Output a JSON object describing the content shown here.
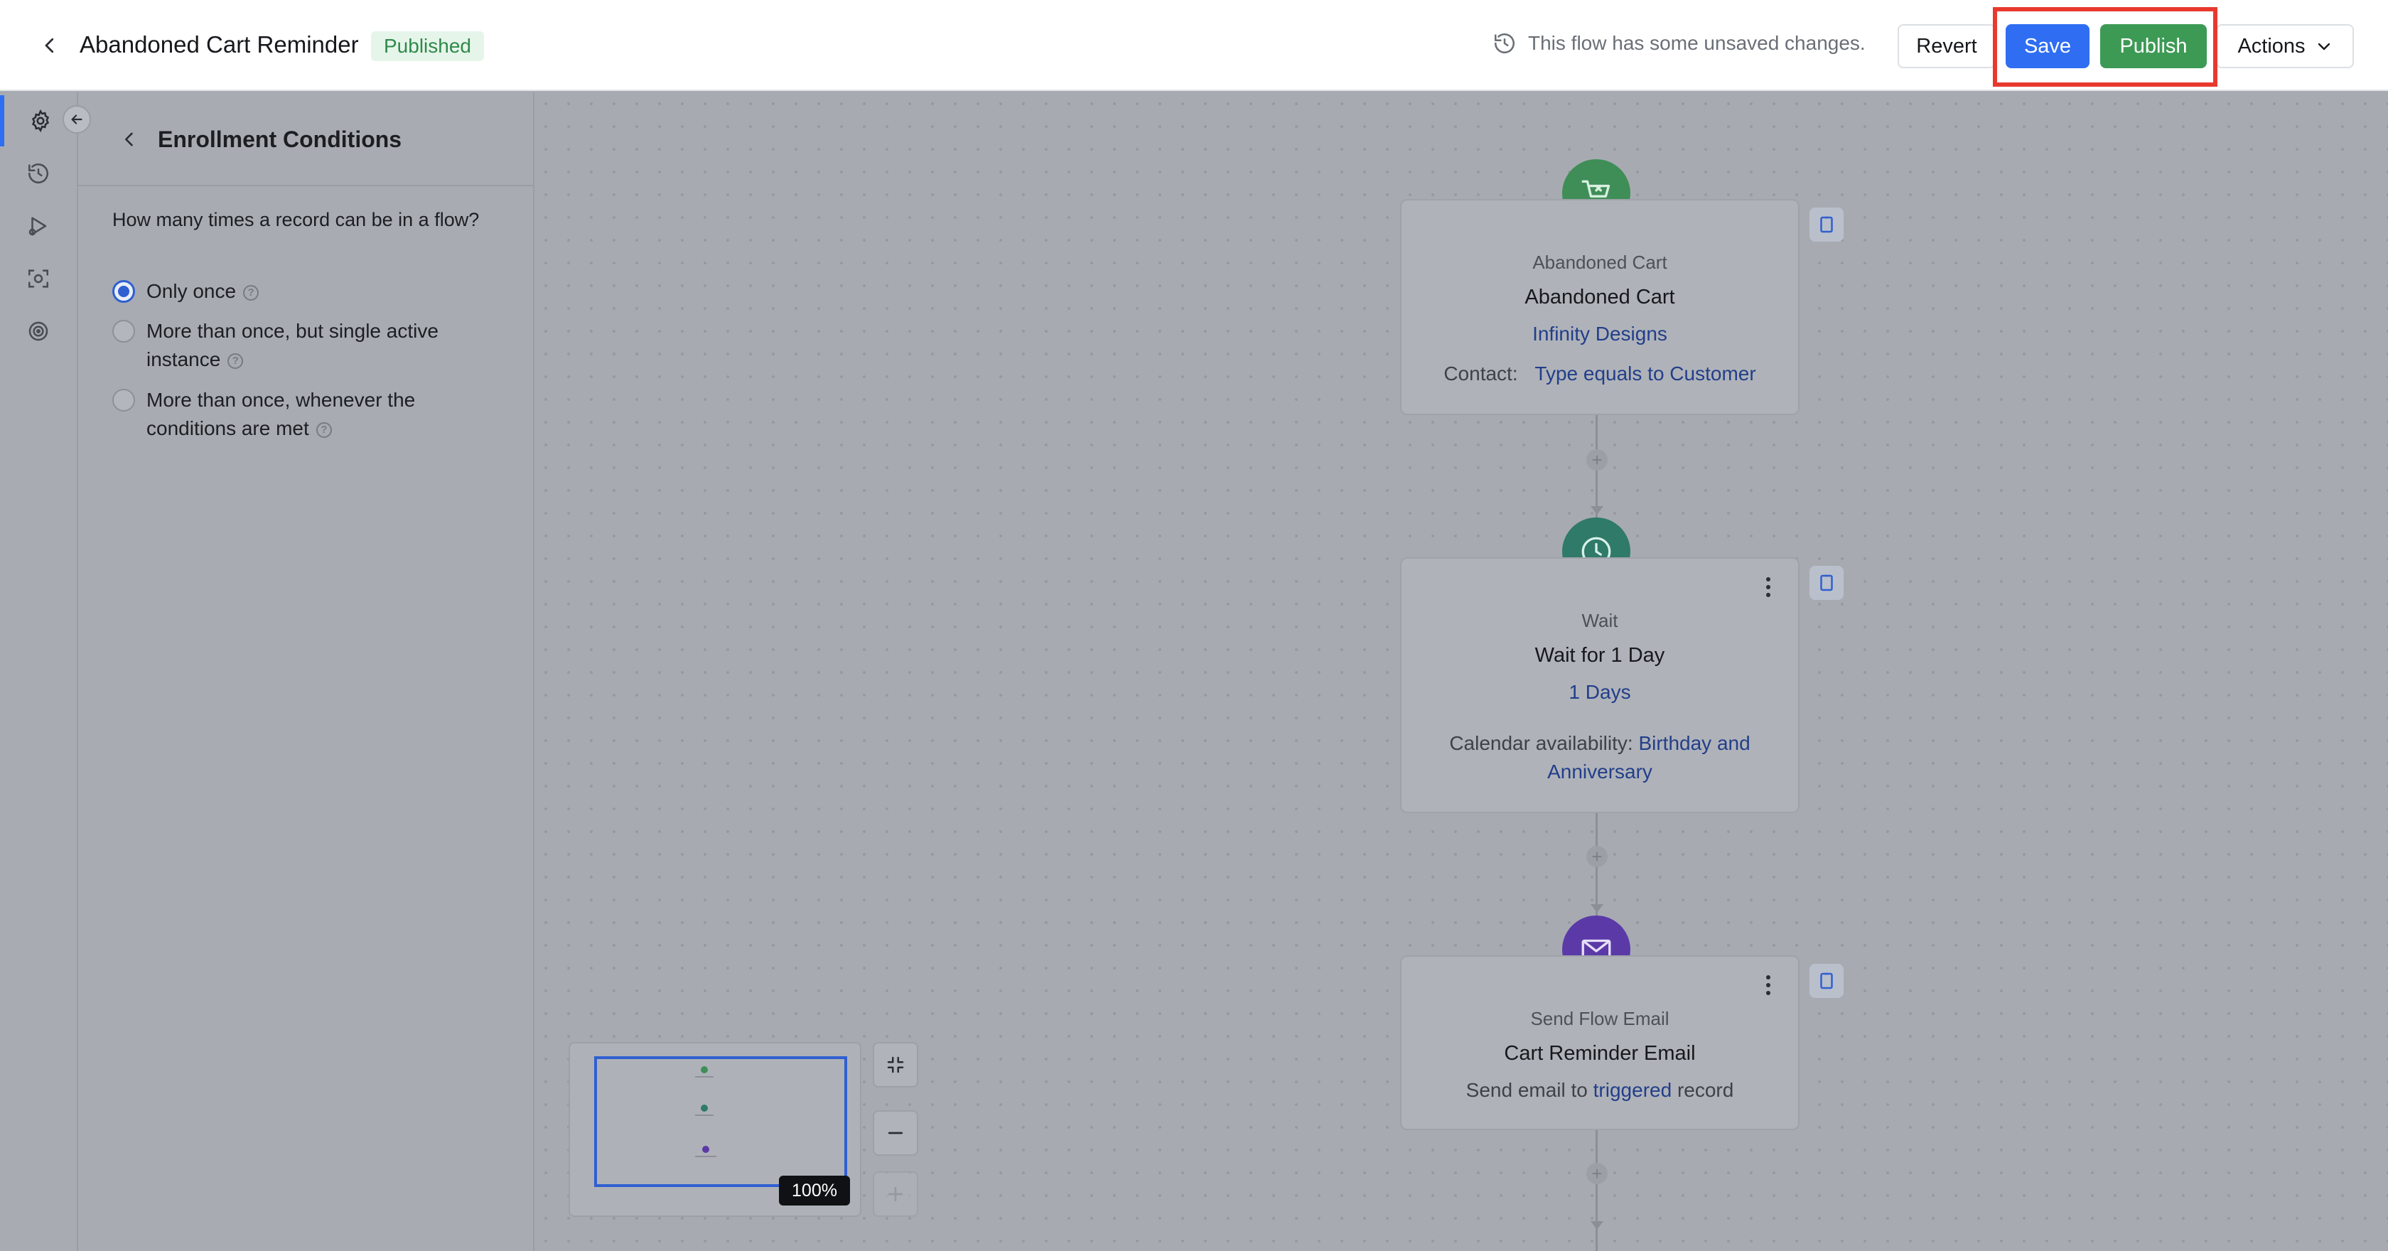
{
  "header": {
    "title": "Abandoned Cart Reminder",
    "status": "Published",
    "unsaved_message": "This flow has some unsaved changes.",
    "revert_label": "Revert",
    "save_label": "Save",
    "publish_label": "Publish",
    "actions_label": "Actions"
  },
  "sidebar": {
    "items": [
      {
        "icon": "gear-icon",
        "active": true
      },
      {
        "icon": "history-icon",
        "active": false
      },
      {
        "icon": "play-icon",
        "active": false
      },
      {
        "icon": "scan-icon",
        "active": false
      },
      {
        "icon": "target-icon",
        "active": false
      }
    ]
  },
  "panel": {
    "title": "Enrollment Conditions",
    "question": "How many times a record can be in a flow?",
    "options": [
      {
        "label": "Only once",
        "checked": true
      },
      {
        "label": "More than once, but single active instance",
        "checked": false
      },
      {
        "label": "More than once, whenever the conditions are met",
        "checked": false
      }
    ]
  },
  "flow": {
    "nodes": [
      {
        "type": "Abandoned Cart",
        "name": "Abandoned Cart",
        "detail": "Infinity Designs",
        "condition_label": "Contact:",
        "condition_value": "Type equals to Customer",
        "icon": "cart-icon",
        "icon_color": "#3f8e57"
      },
      {
        "type": "Wait",
        "name": "Wait for 1 Day",
        "detail": "1 Days",
        "calendar_label": "Calendar availability:",
        "calendar_value": "Birthday and Anniversary",
        "icon": "clock-icon",
        "icon_color": "#2f7a68"
      },
      {
        "type": "Send Flow Email",
        "name": "Cart Reminder Email",
        "detail_prefix": "Send email to",
        "detail_link": "triggered",
        "detail_suffix": "record",
        "icon": "mail-icon",
        "icon_color": "#5b3aa8"
      }
    ]
  },
  "canvas_controls": {
    "zoom_level": "100%"
  },
  "colors": {
    "accent_blue": "#2f6ef2",
    "publish_green": "#3d9a55",
    "highlight_red": "#e8392f"
  }
}
